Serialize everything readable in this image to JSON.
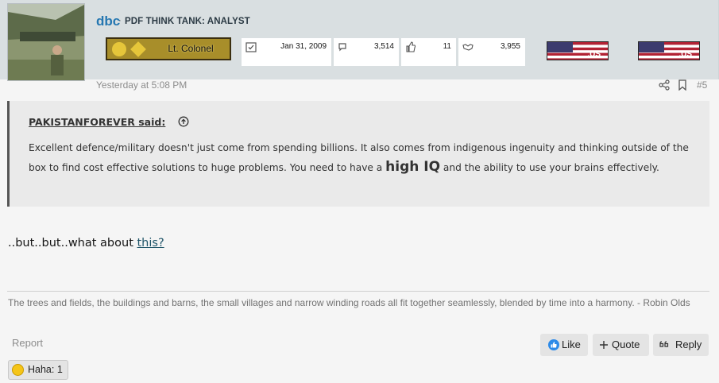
{
  "user": {
    "name": "dbc",
    "separator": "·",
    "title": "PDF THINK TANK: ANALYST",
    "rank": "Lt. Colonel"
  },
  "stats": {
    "joined": "Jan 31, 2009",
    "messages": "3,514",
    "reactions": "11",
    "points": "3,955"
  },
  "flags": [
    {
      "label": ".US"
    },
    {
      "label": ".US"
    }
  ],
  "post": {
    "timestamp": "Yesterday at 5:08 PM",
    "number": "#5",
    "quote_author": "PAKISTANFOREVER said:",
    "quote_text_1": "Excellent defence/military doesn't just come from spending billions. It also comes from indigenous ingenuity and thinking outside of the box to find cost effective solutions to huge problems. You need to have a ",
    "quote_highlight": "high IQ",
    "quote_text_2": " and the ability to use your brains effectively.",
    "body_prefix": "..but..but..what about ",
    "body_link": "this?",
    "signature": "The trees and fields, the buildings and barns, the small villages and narrow winding roads all fit together seamlessly, blended by time into a harmony. - Robin Olds"
  },
  "actions": {
    "report": "Report",
    "like": "Like",
    "quote": "Quote",
    "reply": "Reply"
  },
  "reaction_summary": "Haha: 1",
  "colors": {
    "username": "#2577b1",
    "header_bg": "#d9dfe1",
    "rank_bg": "#a88e2a",
    "link": "#1f5468"
  }
}
